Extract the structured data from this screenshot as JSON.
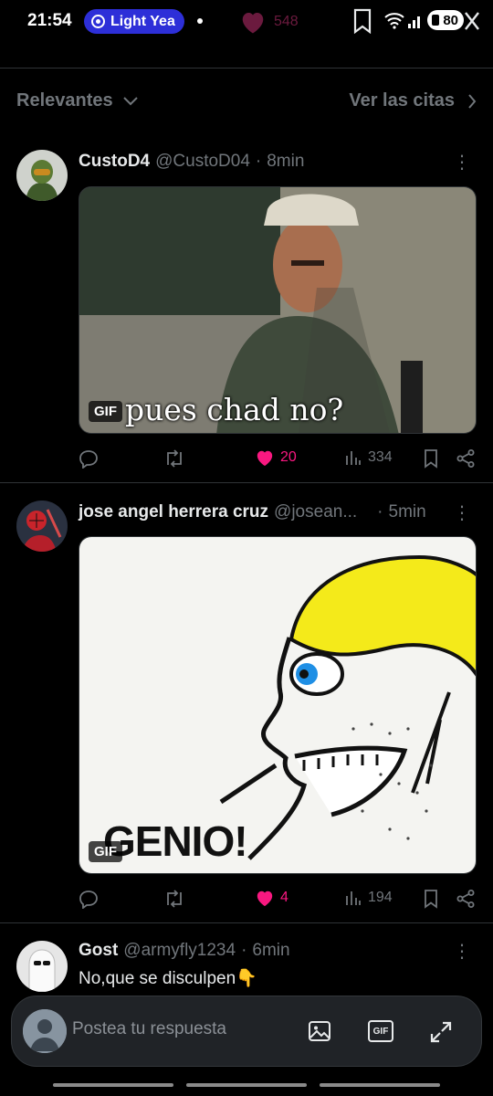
{
  "status_bar": {
    "time": "21:54",
    "pill_label": "Light Yea",
    "like_count": "548",
    "battery": "80"
  },
  "sort": {
    "left_label": "Relevantes",
    "right_label": "Ver las citas"
  },
  "tweets": [
    {
      "name": "CustoD4",
      "handle": "@CustoD04",
      "sep": "·",
      "time": "8min",
      "media_caption": "pues chad no?",
      "gif_label": "GIF",
      "likes": "20",
      "views": "334",
      "liked": true
    },
    {
      "name": "jose angel herrera cruz",
      "handle": "@josean...",
      "sep": "·",
      "time": "5min",
      "media_caption": "GENIO!",
      "gif_label": "GIF",
      "likes": "4",
      "views": "194",
      "liked": true
    },
    {
      "name": "Gost",
      "handle": "@armyfly1234",
      "sep": "·",
      "time": "6min",
      "text": "No,que se disculpen👇"
    }
  ],
  "composer": {
    "placeholder": "Postea tu respuesta",
    "gif_label": "GIF"
  },
  "colors": {
    "like": "#f91880",
    "muted": "#71767b",
    "pill": "#2d2fd8"
  }
}
